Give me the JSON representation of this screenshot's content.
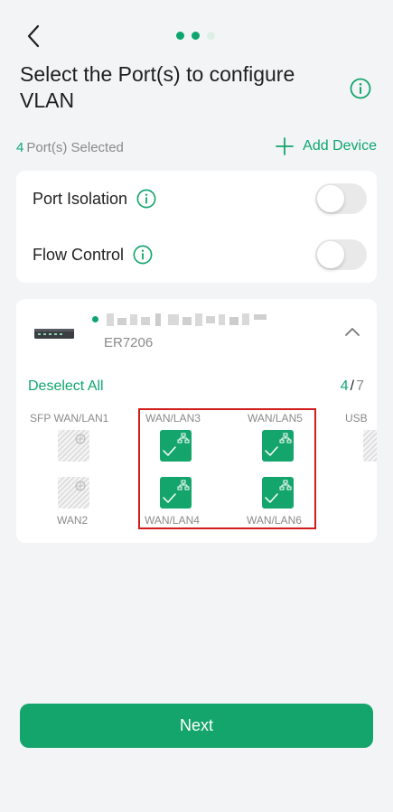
{
  "header": {
    "back_icon": "chevron-left-icon",
    "steps": {
      "total": 3,
      "current": 2
    },
    "title": "Select the Port(s) to configure VLAN",
    "info_icon": "info-circle-icon"
  },
  "selection": {
    "count": "4",
    "count_label": "Port(s) Selected",
    "add_device_label": "Add Device"
  },
  "settings": [
    {
      "label": "Port Isolation",
      "enabled": false
    },
    {
      "label": "Flow Control",
      "enabled": false
    }
  ],
  "device": {
    "model": "ER7206",
    "status": "online",
    "name_obscured": true,
    "deselect_label": "Deselect All",
    "selected_count": "4",
    "separator": "/",
    "total_count": "7",
    "ports_top": [
      {
        "label": "SFP WAN/LAN1",
        "state": "disabled"
      },
      {
        "label": "WAN/LAN3",
        "state": "selected"
      },
      {
        "label": "WAN/LAN5",
        "state": "selected"
      },
      {
        "label": "USB",
        "state": "disabled"
      }
    ],
    "ports_bottom": [
      {
        "label": "WAN2",
        "state": "disabled"
      },
      {
        "label": "WAN/LAN4",
        "state": "selected"
      },
      {
        "label": "WAN/LAN6",
        "state": "selected"
      }
    ]
  },
  "footer": {
    "next_label": "Next"
  },
  "colors": {
    "accent": "#14a56c",
    "background": "#f3f4f6",
    "highlight": "#d21c1c"
  }
}
